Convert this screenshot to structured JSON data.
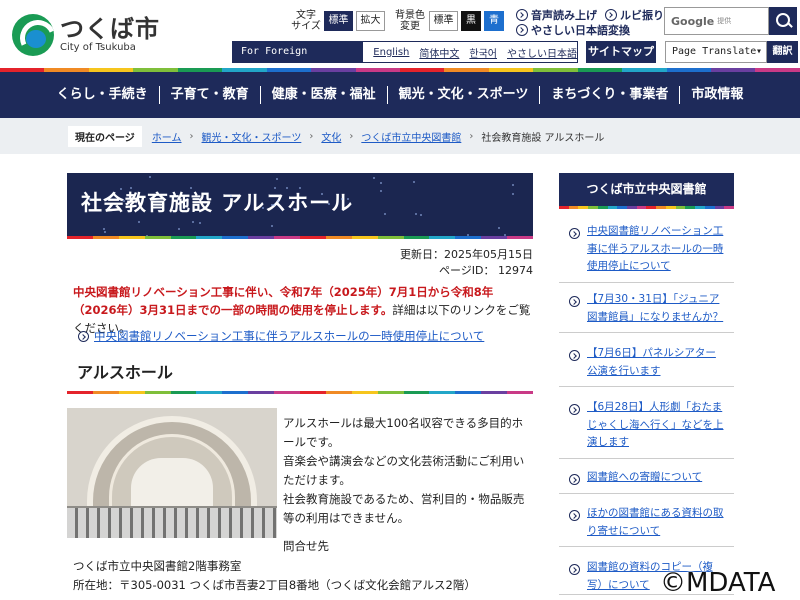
{
  "header": {
    "logo_jp": "つくば市",
    "logo_en": "City of Tsukuba",
    "font_size_label": "文字\nサイズ",
    "font_standard": "標準",
    "font_large": "拡大",
    "bgcolor_label": "背景色\n変更",
    "bg_standard": "標準",
    "bg_black": "黒",
    "bg_blue": "青",
    "read_aloud": "音声読み上げ",
    "ruby": "ルビ振り",
    "easy_jp": "やさしい日本語変換",
    "search_logo": "Google",
    "search_sub": "提供",
    "foreign_label": "For Foreign Residents",
    "languages": [
      "English",
      "简体中文",
      "한국어",
      "やさしい日本語"
    ],
    "sitemap": "サイトマップ",
    "translate_select": "Page Translate",
    "translate_btn": "翻訳"
  },
  "colors": {
    "navy": "#1e2a5a",
    "stripe": [
      "#e4232b",
      "#f08a24",
      "#f6c51d",
      "#7fbf3a",
      "#1a9b54",
      "#22a6c8",
      "#1d6fce",
      "#6a3fa0",
      "#c93a86",
      "#e4232b",
      "#f08a24",
      "#f6c51d",
      "#7fbf3a",
      "#1a9b54",
      "#22a6c8",
      "#1d6fce",
      "#6a3fa0",
      "#c93a86"
    ]
  },
  "gnav": [
    "くらし・手続き",
    "子育て・教育",
    "健康・医療・福祉",
    "観光・文化・スポーツ",
    "まちづくり・事業者",
    "市政情報"
  ],
  "breadcrumb": {
    "label": "現在のページ",
    "links": [
      "ホーム",
      "観光・文化・スポーツ",
      "文化",
      "つくば市立中央図書館"
    ],
    "current": "社会教育施設 アルスホール"
  },
  "main": {
    "title": "社会教育施設 アルスホール",
    "updated": "更新日：2025年05月15日",
    "page_id": "ページID： 12974",
    "notice_red": "中央図書館リノベーション工事に伴い、令和7年（2025年）7月1日から令和8年（2026年）3月31日までの一部の時間の使用を停止します。",
    "notice_rest": "詳細は以下のリンクをご覧ください。",
    "notice_link": "中央図書館リノベーション工事に伴うアルスホールの一時使用停止について",
    "section_title": "アルスホール",
    "desc": [
      "アルスホールは最大100名収容できる多目的ホールです。",
      "音楽会や講演会などの文化芸術活動にご利用いただけます。",
      "社会教育施設であるため、営利目的・物品販売等の利用はできません。"
    ],
    "contact_heading": "問合せ先",
    "contact_office": "つくば市立中央図書館2階事務室",
    "contact_address": "所在地：〒305-0031 つくば市吾妻2丁目8番地（つくば文化会館アルス2階）"
  },
  "sidebar": {
    "title": "つくば市立中央図書館",
    "items": [
      "中央図書館リノベーション工事に伴うアルスホールの一時使用停止について",
      "【7月30・31日】「ジュニア図書館員」になりませんか？",
      "【7月6日】パネルシアター公演を行います",
      "【6月28日】人形劇「おたまじゃくし海へ行く」などを上演します",
      "図書館への寄贈について",
      "ほかの図書館にある資料の取り寄せについて",
      "図書館の資料のコピー（複写）について"
    ]
  },
  "watermark": "©MDATA"
}
